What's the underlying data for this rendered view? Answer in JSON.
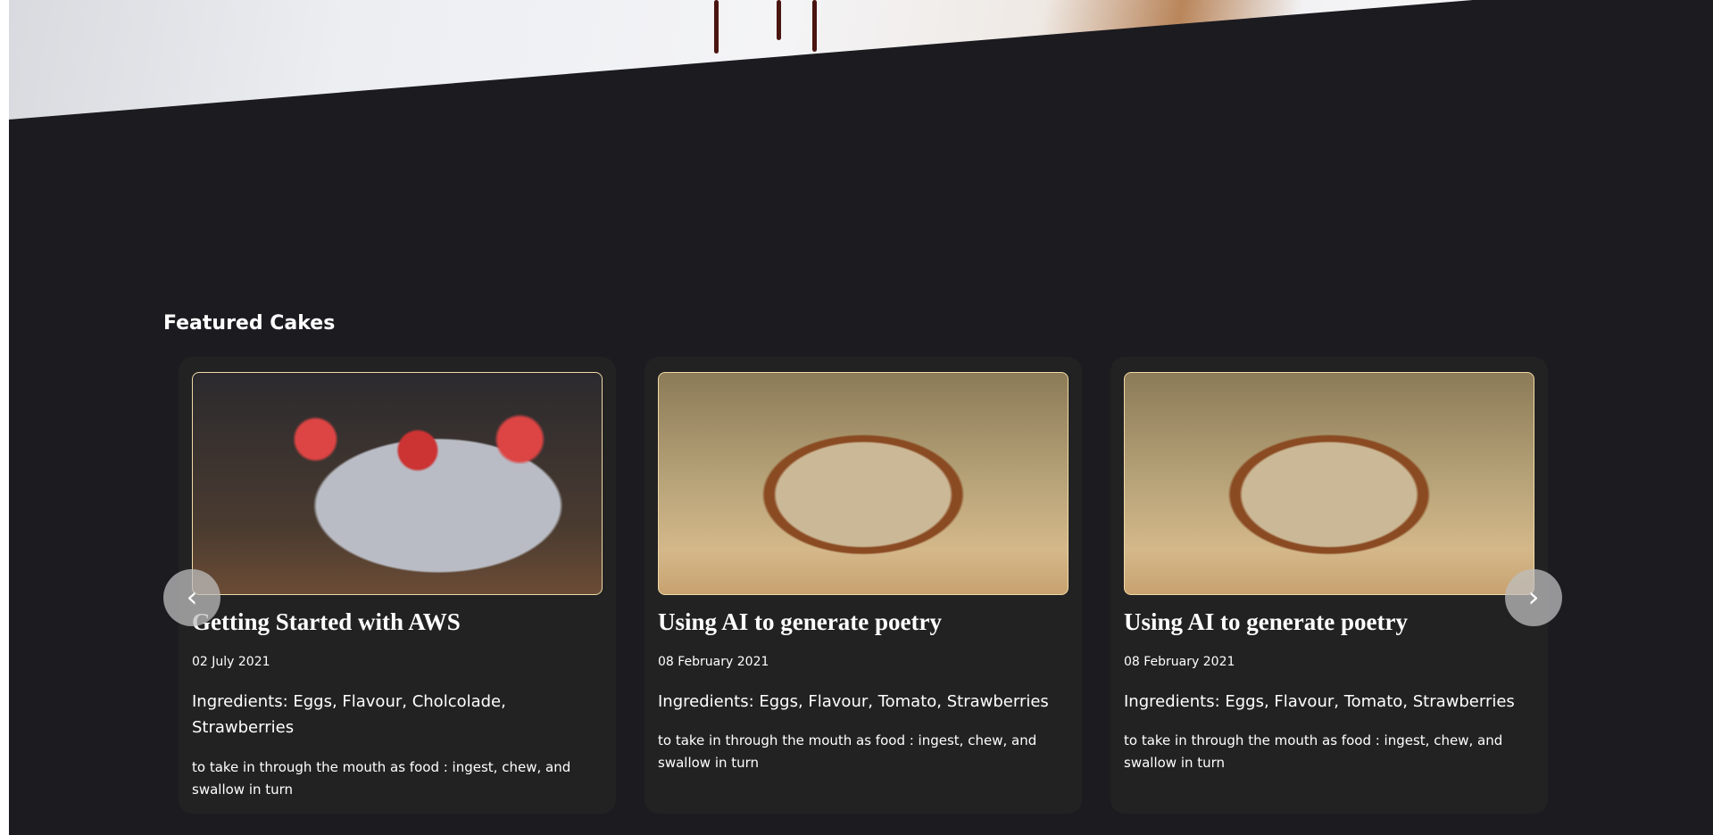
{
  "section": {
    "heading": "Featured Cakes"
  },
  "carousel": {
    "prev_icon": "chevron-left-icon",
    "next_icon": "chevron-right-icon",
    "prev_glyph": "‹",
    "next_glyph": "›",
    "cards": [
      {
        "image": "strawberry-cupcakes",
        "title": "Getting Started with AWS",
        "date": "02 July 2021",
        "ingredients": "Ingredients: Eggs, Flavour, Cholcolade, Strawberries",
        "description": "to take in through the mouth as food : ingest, chew, and swallow in turn"
      },
      {
        "image": "bread-loaf",
        "title": "Using AI to generate poetry",
        "date": "08 February 2021",
        "ingredients": "Ingredients: Eggs, Flavour, Tomato, Strawberries",
        "description": "to take in through the mouth as food : ingest, chew, and swallow in turn"
      },
      {
        "image": "bread-loaf",
        "title": "Using AI to generate poetry",
        "date": "08 February 2021",
        "ingredients": "Ingredients: Eggs, Flavour, Tomato, Strawberries",
        "description": "to take in through the mouth as food : ingest, chew, and swallow in turn"
      }
    ]
  },
  "colors": {
    "background": "#1c1b20",
    "card": "#222223",
    "image_border": "#f0d9a6"
  }
}
